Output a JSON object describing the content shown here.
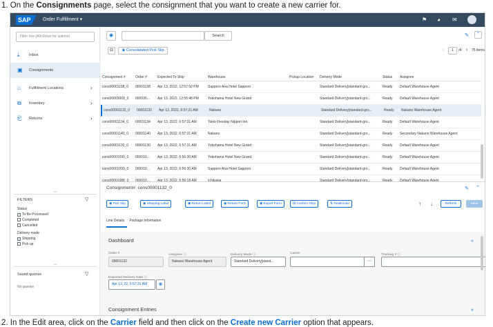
{
  "instructions": {
    "step1_prefix": "1. On the ",
    "step1_bold": "Consignments",
    "step1_suffix": " page, select the consignment that you want to create a new carrier for.",
    "step2_prefix": "2. In the Edit area, click on the ",
    "step2_link1": "Carrier",
    "step2_mid": " field and then click on the ",
    "step2_link2": "Create new Carrier",
    "step2_suffix": " option that appears."
  },
  "shell": {
    "logo": "SAP",
    "title": "Order Fulfillment ▾",
    "icons": [
      "&#9881;",
      "&#9906;",
      "&#9993;"
    ]
  },
  "sidebar": {
    "filter_placeholder": "Filter tree (Alt+Down for options)",
    "items": [
      {
        "label": "Inbox",
        "icon": "⤓",
        "chevron": ""
      },
      {
        "label": "Consignments",
        "icon": "▣",
        "chevron": ""
      },
      {
        "label": "Fulfillment Locations",
        "icon": "⌂",
        "chevron": "›"
      },
      {
        "label": "Inventory",
        "icon": "⧉",
        "chevron": "›"
      },
      {
        "label": "Returns",
        "icon": "⎗",
        "chevron": "›"
      }
    ],
    "filters_title": "FILTERS",
    "status_label": "Status",
    "status_options": [
      {
        "label": "To Be Processed",
        "checked": true
      },
      {
        "label": "Completed",
        "checked": false
      },
      {
        "label": "Cancelled",
        "checked": false
      }
    ],
    "delivery_label": "Delivery mode",
    "delivery_options": [
      {
        "label": "Shipping",
        "checked": true
      },
      {
        "label": "Pick up",
        "checked": false
      }
    ],
    "saved_queries": "Saved queries",
    "no_queries": "No queries"
  },
  "toolbar": {
    "search_button": "Search",
    "consolidated_button": "Consolidated Pick Slip",
    "page_current": "1",
    "page_total": "/4",
    "items_count": "75 items"
  },
  "table": {
    "headers": [
      "Consignment #",
      "Order #",
      "Expected To Ship",
      "Warehouse",
      "Pickup Location",
      "Delivery Mode",
      "Status",
      "Assignee"
    ],
    "rows": [
      [
        "cons00001158_0",
        "00001158",
        "Apr 13, 2022, 12:57:50 PM",
        "Sapporo Ana Hotel Sapporo",
        "",
        "Standard Delivery[standard-gro...",
        "Ready",
        "Default Warehouse Agent"
      ],
      [
        "cons00003009_0",
        "000030...",
        "Apr 13, 2022, 12:55:48 PM",
        "Yokohama Hotel New Grand",
        "",
        "Standard Delivery[standard-gro...",
        "Ready",
        "Default Warehouse Agent"
      ],
      [
        "cons00001132_0",
        "00001132",
        "Apr 13, 2022, 6:57:31 AM",
        "Nakano",
        "",
        "Standard Delivery[standard-gro...",
        "Ready",
        "Nakano Warehouse Agent"
      ],
      [
        "cons00001134_0",
        "00001134",
        "Apr 13, 2022, 6:57:31 AM",
        "Tokio Flexstay Nippori Inn",
        "",
        "Standard Delivery[standard-gro...",
        "Ready",
        "Default Warehouse Agent"
      ],
      [
        "cons00001140_0",
        "00001140",
        "Apr 13, 2022, 6:57:31 AM",
        "Nakano",
        "",
        "Standard Delivery[standard-gro...",
        "Ready",
        "Secondary Nakano Warehouse Agent"
      ],
      [
        "cons00001130_0",
        "00001130",
        "Apr 13, 2022, 6:57:31 AM",
        "Yokohama Hotel New Grand",
        "",
        "Standard Delivery[standard-gro...",
        "Ready",
        "Default Warehouse Agent"
      ],
      [
        "cons00001090_0",
        "000010...",
        "Apr 13, 2022, 6:56:30 AM",
        "Yokohama Hotel New Grand",
        "",
        "Standard Delivery[standard-gro...",
        "Ready",
        "Default Warehouse Agent"
      ],
      [
        "cons00001099_0",
        "000010...",
        "Apr 13, 2022, 6:56:30 AM",
        "Sapporo Ana Hotel Sapporo",
        "",
        "Standard Delivery[standard-gro...",
        "Ready",
        "Default Warehouse Agent"
      ],
      [
        "cons00001088_0",
        "000010...",
        "Apr 13, 2022, 6:56:18 AM",
        "Ichikawa",
        "",
        "Standard Delivery[standard-gro...",
        "Ready",
        "Default Warehouse Agent"
      ]
    ],
    "selected_index": 2
  },
  "detail": {
    "title": "Consignment#: cons00001132_0",
    "actions": [
      "Pick Slip",
      "Shipping Label",
      "Return Label",
      "Return Form",
      "Export Form",
      "Confirm Ship",
      "Reallocate"
    ],
    "refresh": "Refresh",
    "save": "Save",
    "tabs": [
      "Line Details",
      "Package Information"
    ],
    "dashboard_title": "Dashboard",
    "order_label": "Order #",
    "order_value": "00001132",
    "assignee_label": "Assignee ⓘ",
    "assignee_value": "Nakano Warehouse Agent",
    "delivery_label": "Delivery Mode ⓘ",
    "delivery_value": "Standard Delivery[stand...",
    "carrier_label": "Carrier",
    "carrier_value": "",
    "tracking_label": "Tracking # ⓘ",
    "tracking_value": "",
    "expected_label": "Expected Delivery Date ⓘ",
    "expected_value": "Apr 13, 22, 6:57:31 AM",
    "entries_title": "Consignment Entries"
  }
}
